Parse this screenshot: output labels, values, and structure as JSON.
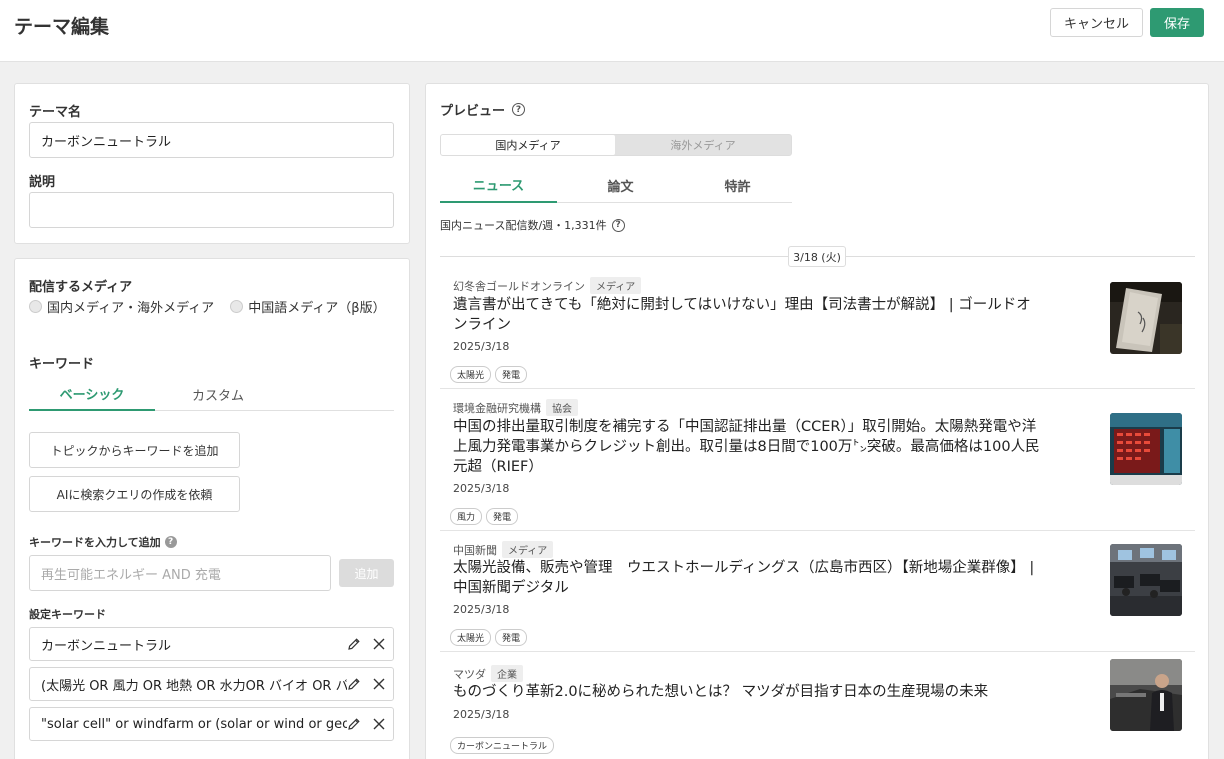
{
  "header": {
    "title": "テーマ編集",
    "cancel_label": "キャンセル",
    "save_label": "保存"
  },
  "theme": {
    "name_label": "テーマ名",
    "name_value": "カーボンニュートラル",
    "desc_label": "説明",
    "desc_value": ""
  },
  "media": {
    "section_label": "配信するメディア",
    "options": [
      "国内メディア・海外メディア",
      "中国語メディア（β版）"
    ]
  },
  "keywords": {
    "section_label": "キーワード",
    "tabs": [
      "ベーシック",
      "カスタム"
    ],
    "add_from_topic_label": "トピックからキーワードを追加",
    "ai_query_label": "AIに検索クエリの作成を依頼",
    "input_label": "キーワードを入力して追加",
    "input_placeholder": "再生可能エネルギー AND 充電",
    "add_label": "追加",
    "set_label": "設定キーワード",
    "items": [
      "カーボンニュートラル",
      "(太陽光 OR 風力 OR 地熱 OR 水力OR バイオ OR バイオマス",
      "\"solar cell\" or windfarm or (solar or wind or geothermal"
    ]
  },
  "preview": {
    "title": "プレビュー",
    "segments": [
      "国内メディア",
      "海外メディア"
    ],
    "tabs": [
      "ニュース",
      "論文",
      "特許"
    ],
    "weekly_count": "国内ニュース配信数/週・1,331件",
    "date_chip": "3/18 (火)",
    "news": [
      {
        "source": "幻冬舎ゴールドオンライン",
        "badge": "メディア",
        "title": "遺言書が出てきても「絶対に開封してはいけない」理由【司法書士が解説】 | ゴールドオンライン",
        "date": "2025/3/18",
        "tags": [
          "太陽光",
          "発電"
        ]
      },
      {
        "source": "環境金融研究機構",
        "badge": "協会",
        "title": "中国の排出量取引制度を補完する「中国認証排出量（CCER）」取引開始。太陽熱発電や洋上風力発電事業からクレジット創出。取引量は8日間で100万㌧突破。最高価格は100人民元超（RIEF）",
        "date": "2025/3/18",
        "tags": [
          "風力",
          "発電"
        ]
      },
      {
        "source": "中国新聞",
        "badge": "メディア",
        "title": "太陽光設備、販売や管理　ウエストホールディングス（広島市西区）【新地場企業群像】 | 中国新聞デジタル",
        "date": "2025/3/18",
        "tags": [
          "太陽光",
          "発電"
        ]
      },
      {
        "source": "マツダ",
        "badge": "企業",
        "title": "ものづくり革新2.0に秘められた想いとは？ マツダが目指す日本の生産現場の未来",
        "date": "2025/3/18",
        "tags": [
          "カーボンニュートラル"
        ]
      }
    ]
  },
  "colors": {
    "accent": "#2e9a72"
  }
}
